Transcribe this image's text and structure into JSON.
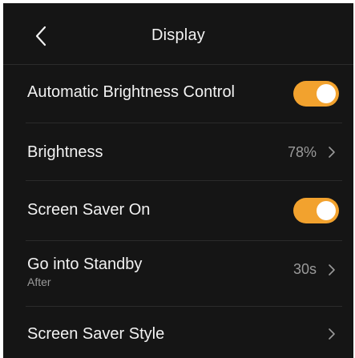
{
  "header": {
    "title": "Display",
    "back_icon": "chevron-left-icon"
  },
  "settings": [
    {
      "label": "Automatic Brightness Control",
      "control": "toggle",
      "on": true
    },
    {
      "label": "Brightness",
      "value": "78%",
      "control": "chevron"
    },
    {
      "label": "Screen Saver On",
      "control": "toggle",
      "on": true
    },
    {
      "label": "Go into Standby",
      "sublabel": "After",
      "value": "30s",
      "control": "chevron"
    },
    {
      "label": "Screen Saver Style",
      "control": "chevron"
    }
  ],
  "colors": {
    "background": "#151515",
    "toggle_on": "#f2a22e",
    "text_primary": "#f2f2f2",
    "text_secondary": "#9a9a9a"
  }
}
